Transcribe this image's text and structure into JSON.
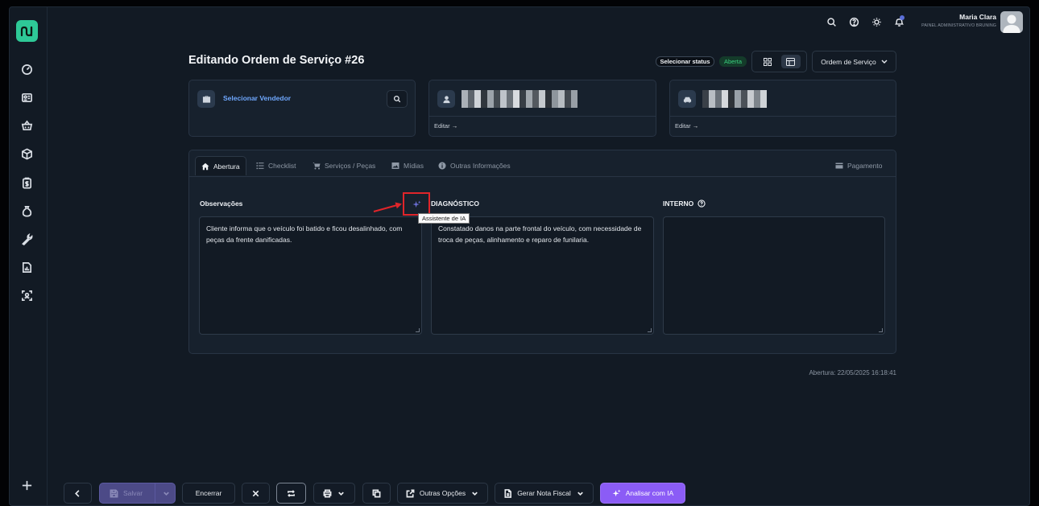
{
  "header": {
    "user_name": "Maria Clara",
    "user_role": "PAINEL ADMINISTRATIVO BRUNING"
  },
  "page": {
    "title": "Editando Ordem de Serviço #26",
    "select_status": "Selecionar status",
    "status": "Aberta",
    "type_dropdown": "Ordem de Serviço"
  },
  "cards": {
    "vendor_label": "Selecionar Vendedor",
    "client_edit": "Editar",
    "vehicle_edit": "Editar"
  },
  "tabs": [
    {
      "label": "Abertura",
      "icon": "home-icon"
    },
    {
      "label": "Checklist",
      "icon": "list-icon"
    },
    {
      "label": "Serviços / Peças",
      "icon": "cart-icon"
    },
    {
      "label": "Mídias",
      "icon": "image-icon"
    },
    {
      "label": "Outras Informações",
      "icon": "info-icon"
    },
    {
      "label": "Pagamento",
      "icon": "card-icon"
    }
  ],
  "fields": {
    "observacoes_label": "Observações",
    "observacoes_text": "Cliente informa que o veículo foi batido e ficou desalinhado, com peças da frente danificadas.",
    "diagnostico_label": "DIAGNÓSTICO",
    "diagnostico_text": "Constatado danos na parte frontal do veículo, com necessidade de troca de peças, alinhamento e reparo de funilaria.",
    "interno_label": "INTERNO",
    "interno_text": ""
  },
  "tooltip": "Assistente de IA",
  "abertura_timestamp": "Abertura: 22/05/2025 16:18:41",
  "bottom": {
    "save": "Salvar",
    "close": "Encerrar",
    "other_options": "Outras Opções",
    "invoice": "Gerar Nota Fiscal",
    "ai_analyze": "Analisar com IA"
  },
  "colors": {
    "accent_green": "#2ec997",
    "status_green": "#3ad07e",
    "primary_purple": "#8b5cf6",
    "link_blue": "#6fa8ff",
    "highlight_red": "#e0252a"
  }
}
